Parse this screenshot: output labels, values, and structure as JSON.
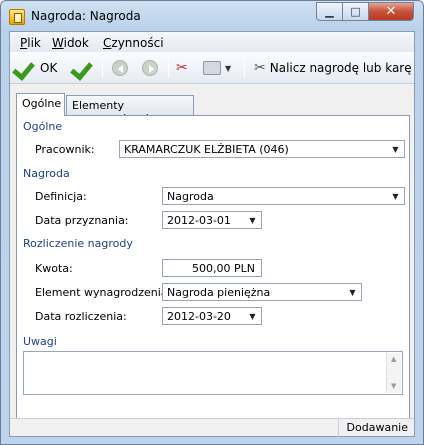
{
  "window": {
    "title": "Nagroda: Nagroda"
  },
  "menu": {
    "items": [
      {
        "label": "Plik",
        "underline": "P"
      },
      {
        "label": "Widok",
        "underline": "W"
      },
      {
        "label": "Czynności",
        "underline": "C"
      }
    ]
  },
  "toolbar": {
    "ok_label": "OK",
    "compute_label": "Nalicz nagrodę lub karę"
  },
  "tabs": [
    {
      "label": "Ogólne",
      "active": true
    },
    {
      "label": "Elementy wynagrodzenia",
      "active": false
    }
  ],
  "sections": {
    "general": "Ogólne",
    "award": "Nagroda",
    "settlement": "Rozliczenie nagrody",
    "notes": "Uwagi"
  },
  "fields": {
    "employee": {
      "label": "Pracownik:",
      "value": "KRAMARCZUK ELŻBIETA (046)"
    },
    "definition": {
      "label": "Definicja:",
      "value": "Nagroda"
    },
    "grant_date": {
      "label": "Data przyznania:",
      "value": "2012-03-01"
    },
    "amount": {
      "label": "Kwota:",
      "value": "500,00 PLN"
    },
    "pay_element": {
      "label": "Element wynagrodzenia:",
      "value": "Nagroda pieniężna"
    },
    "settle_date": {
      "label": "Data rozliczenia:",
      "value": "2012-03-20"
    },
    "notes": {
      "value": ""
    }
  },
  "status": {
    "mode": "Dodawanie"
  },
  "colors": {
    "accent": "#1e3f8a",
    "ok_check": "#3b9a1c",
    "close_button": "#c75038"
  }
}
